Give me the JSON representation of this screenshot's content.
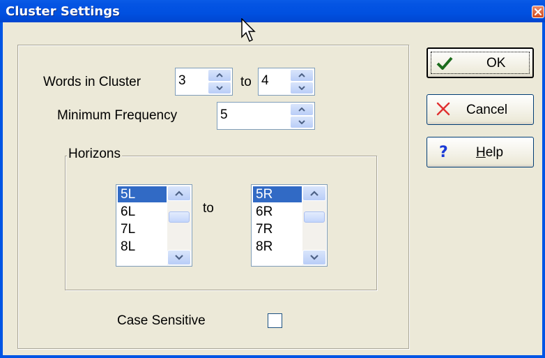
{
  "window": {
    "title": "Cluster Settings"
  },
  "words_in_cluster": {
    "label": "Words in Cluster",
    "from_value": "3",
    "to_label": "to",
    "to_value": "4"
  },
  "minimum_frequency": {
    "label": "Minimum Frequency",
    "value": "5"
  },
  "horizons": {
    "legend": "Horizons",
    "to_label": "to",
    "left_items": [
      "5L",
      "6L",
      "7L",
      "8L"
    ],
    "right_items": [
      "5R",
      "6R",
      "7R",
      "8R"
    ],
    "left_selected": "5L",
    "right_selected": "5R"
  },
  "case_sensitive": {
    "label": "Case Sensitive",
    "checked": false
  },
  "buttons": {
    "ok": "OK",
    "cancel": "Cancel",
    "help": "Help",
    "help_mnemonic": "H"
  },
  "icons": {
    "ok": "check-icon",
    "cancel": "x-icon",
    "help": "question-icon"
  },
  "colors": {
    "title_bar": "#0050e0",
    "selection": "#316ac5",
    "dialog_bg": "#ece9d8"
  }
}
